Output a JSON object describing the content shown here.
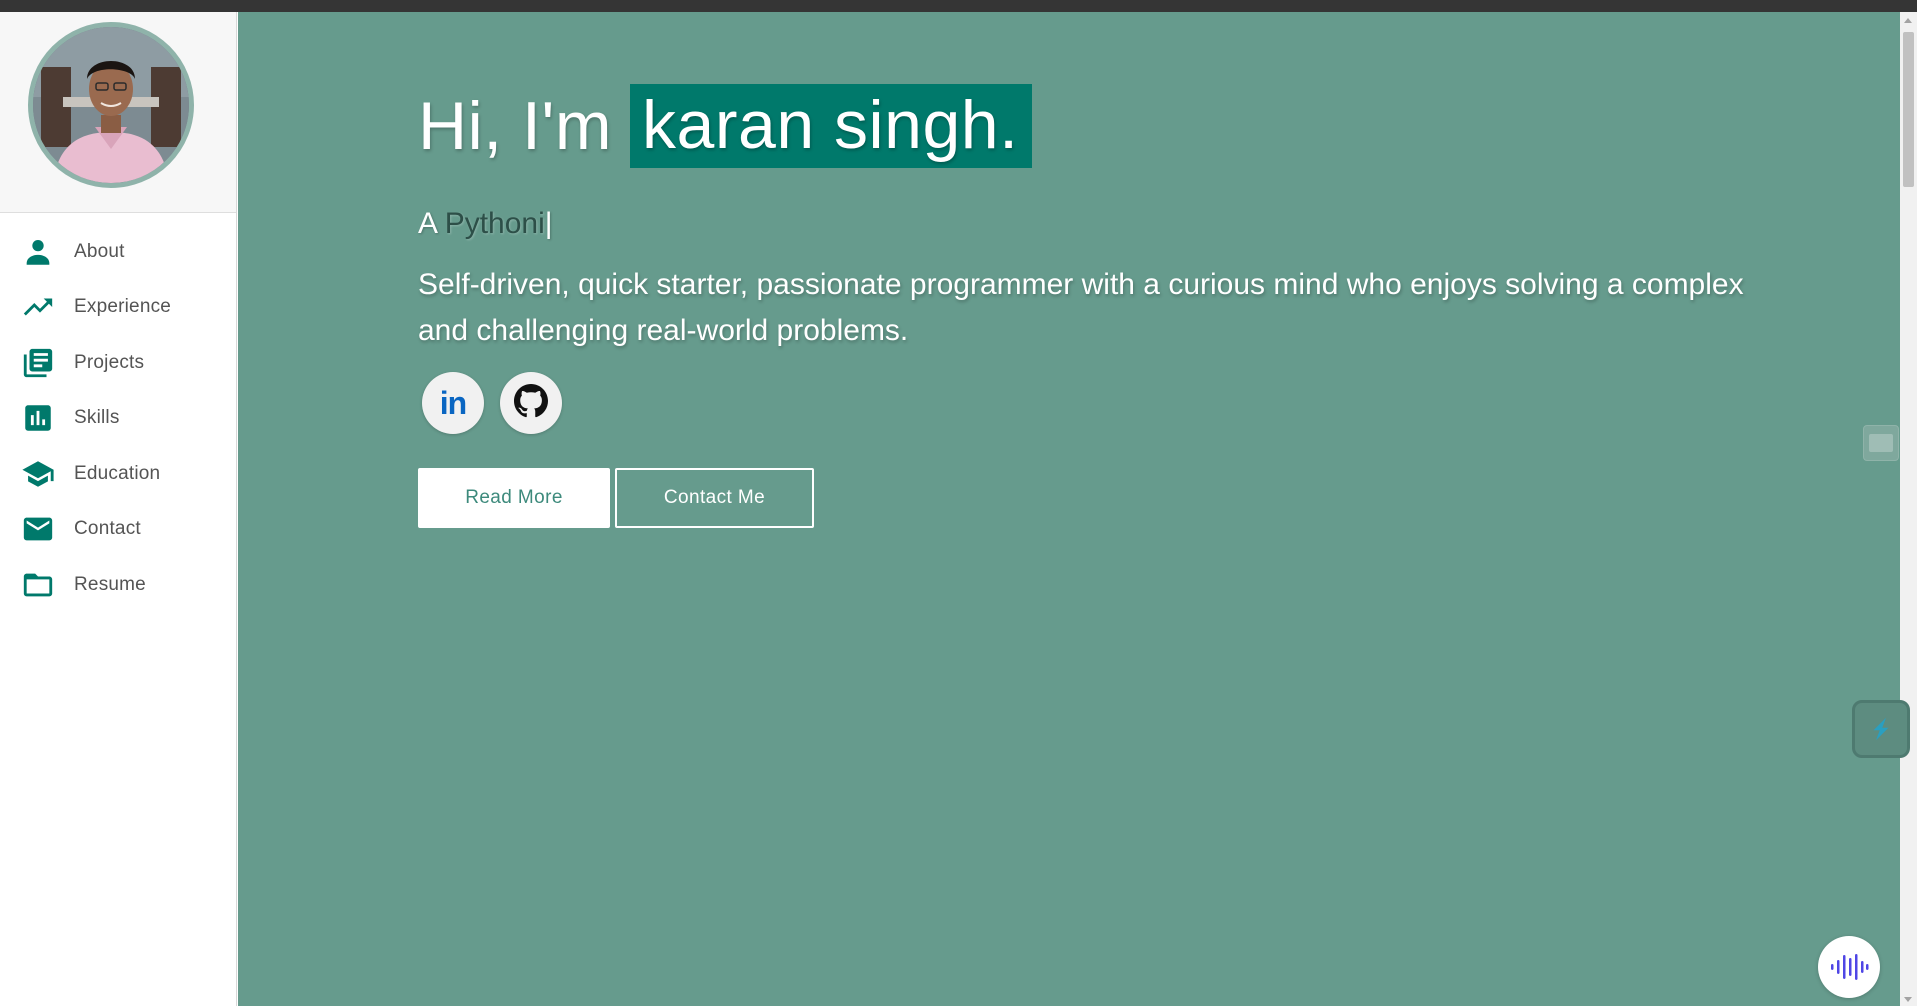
{
  "profile": {
    "name": "karan singh",
    "avatar_alt": "profile photo"
  },
  "sidebar": {
    "items": [
      {
        "label": "About",
        "icon": "person-icon"
      },
      {
        "label": "Experience",
        "icon": "trending-up-icon"
      },
      {
        "label": "Projects",
        "icon": "library-books-icon"
      },
      {
        "label": "Skills",
        "icon": "bar-chart-icon"
      },
      {
        "label": "Education",
        "icon": "graduation-cap-icon"
      },
      {
        "label": "Contact",
        "icon": "mail-icon"
      },
      {
        "label": "Resume",
        "icon": "folder-icon"
      }
    ]
  },
  "hero": {
    "greeting": "Hi, I'm",
    "name_highlight": "karan singh.",
    "typed_prefix": "A ",
    "typed_role": "Pythoni",
    "typed_cursor": "|",
    "bio": "Self-driven, quick starter, passionate programmer with a curious mind who enjoys solving a complex and challenging real-world problems.",
    "socials": [
      {
        "name": "LinkedIn",
        "icon": "linkedin-icon",
        "glyph": "in"
      },
      {
        "name": "GitHub",
        "icon": "github-icon"
      }
    ],
    "buttons": {
      "read_more": "Read More",
      "contact_me": "Contact Me"
    }
  },
  "colors": {
    "accent": "#00796b",
    "hero_background": "#669b8d",
    "sidebar_background": "#ffffff",
    "topbar": "#353535"
  }
}
